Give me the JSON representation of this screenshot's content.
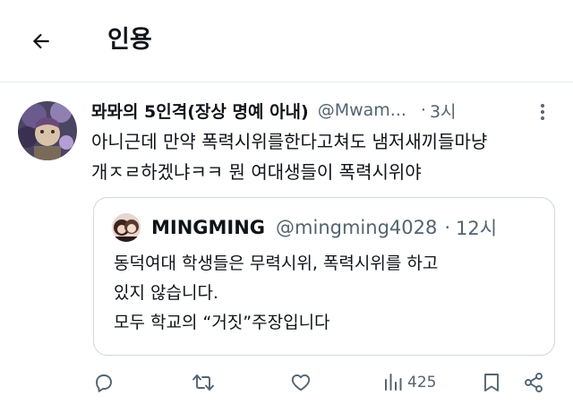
{
  "header": {
    "title": "인용",
    "back_icon": "arrow-left-icon"
  },
  "tweet": {
    "display_name": "뫄뫄의 5인격(장상 명예 아내)",
    "handle": "@Mwam...",
    "separator": "·",
    "time": "3시",
    "text_lines": [
      "아니근데 만약 폭력시위를한다고쳐도 냄저새끼들마냥",
      "개ㅈㄹ하겠냐ㅋㅋ 뭔 여대생들이 폭력시위야"
    ],
    "quoted": {
      "display_name": "MINGMING",
      "handle": "@mingming4028",
      "separator": "·",
      "time": "12시",
      "text_lines": [
        "동덕여대 학생들은 무력시위, 폭력시위를 하고",
        "있지 않습니다.",
        "모두 학교의 “거짓”주장입니다"
      ]
    },
    "actions": {
      "reply_icon": "reply-icon",
      "retweet_icon": "retweet-icon",
      "like_icon": "heart-icon",
      "views_icon": "views-chart-icon",
      "views_count": "425",
      "bookmark_icon": "bookmark-icon",
      "share_icon": "share-icon"
    }
  },
  "colors": {
    "text": "#0f1419",
    "muted": "#536471",
    "border": "#cfd9de",
    "divider": "#e6ecf0"
  }
}
